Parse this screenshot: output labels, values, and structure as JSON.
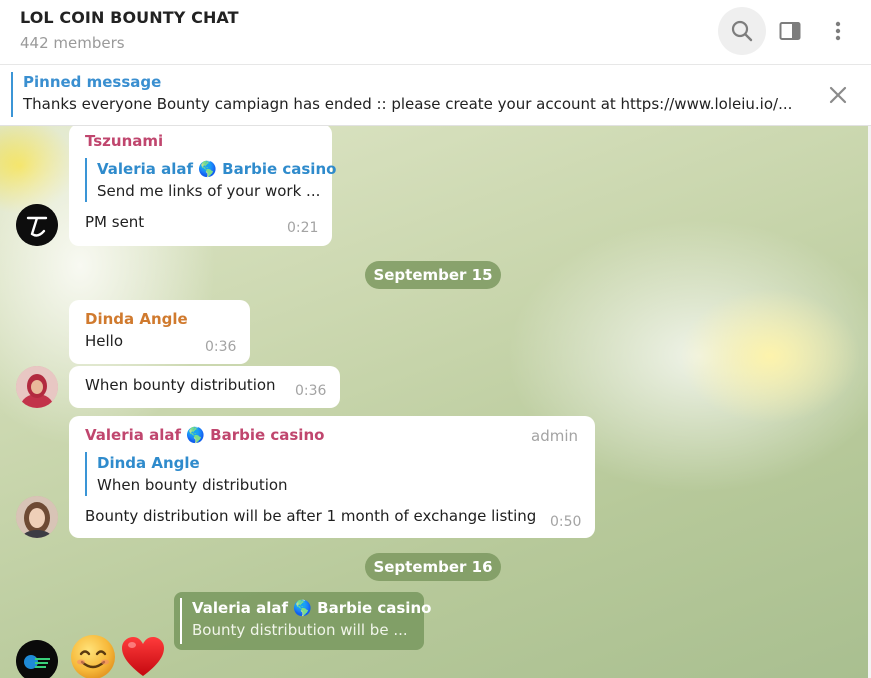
{
  "header": {
    "title": "LOL COIN BOUNTY CHAT",
    "subtitle": "442 members",
    "icons": [
      "search-icon",
      "side-panel-icon",
      "more-vertical-icon"
    ]
  },
  "pinned": {
    "title": "Pinned message",
    "text": "Thanks everyone Bounty campiagn has ended :: please create your account at https://www.loleiu.io/...",
    "close_icon": "close-icon"
  },
  "messages": [
    {
      "sender": "Tszunami",
      "sender_color": "#c0466e",
      "reply": {
        "name": "Valeria alaf 🌎 Barbie casino",
        "text": "Send me links of your work ..."
      },
      "text": "PM sent",
      "time": "0:21"
    },
    {
      "date": "September 15"
    },
    {
      "sender": "Dinda Angle",
      "sender_color": "#d07a2e",
      "text": "Hello",
      "time": "0:36"
    },
    {
      "text": "When bounty distribution",
      "time": "0:36"
    },
    {
      "sender": "Valeria alaf 🌎 Barbie casino",
      "sender_color": "#c0466e",
      "badge": "admin",
      "reply": {
        "name": "Dinda Angle",
        "text": "When bounty distribution"
      },
      "text": "Bounty distribution will be after 1 month of exchange listing",
      "time": "0:50"
    },
    {
      "date": "September 16"
    },
    {
      "forwarded_reply": {
        "name": "Valeria alaf 🌎 Barbie casino",
        "text": "Bounty distribution will be ..."
      },
      "emoji": [
        "smiling-face-emoji",
        "red-heart-emoji"
      ]
    }
  ],
  "colors": {
    "accent": "#3a8fd0",
    "date_pill": "#7c9960"
  }
}
